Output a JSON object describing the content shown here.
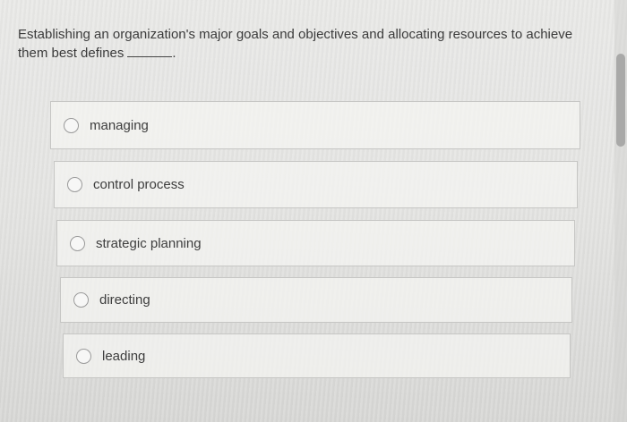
{
  "question": {
    "text": "Establishing an organization's major goals and objectives and allocating resources to achieve them best defines",
    "trailing": "."
  },
  "options": [
    {
      "label": "managing"
    },
    {
      "label": "control process"
    },
    {
      "label": "strategic planning"
    },
    {
      "label": "directing"
    },
    {
      "label": "leading"
    }
  ]
}
